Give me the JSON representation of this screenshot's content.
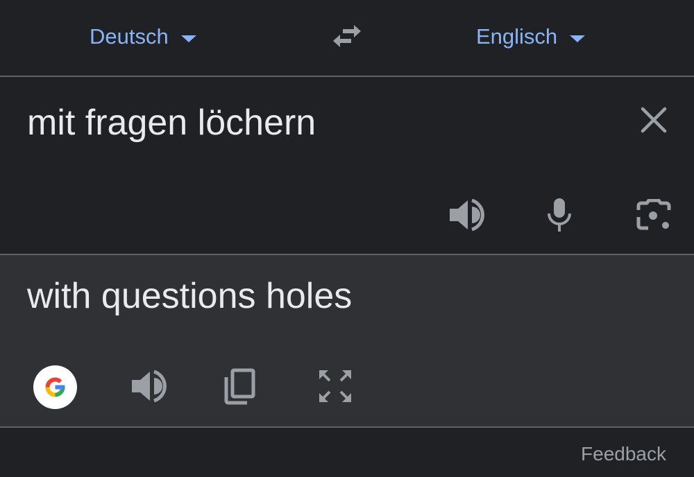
{
  "languages": {
    "source": "Deutsch",
    "target": "Englisch"
  },
  "input": {
    "text": "mit fragen löchern"
  },
  "output": {
    "text": "with questions holes"
  },
  "footer": {
    "feedback_label": "Feedback"
  },
  "icons": {
    "swap": "swap-arrows-icon",
    "clear": "close-icon",
    "speaker": "speaker-icon",
    "mic": "microphone-icon",
    "camera": "camera-icon",
    "google": "google-logo-icon",
    "copy": "copy-icon",
    "fullscreen": "fullscreen-icon"
  },
  "colors": {
    "accent": "#8ab4f8",
    "background": "#202124",
    "output_background": "#303134",
    "text": "#e8eaed",
    "icon": "#9aa0a6"
  }
}
